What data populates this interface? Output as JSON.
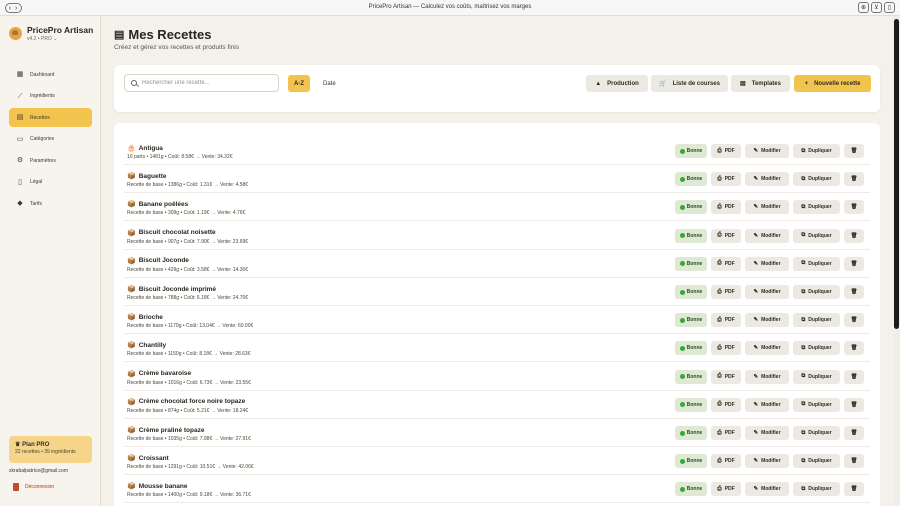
{
  "window": {
    "title": "PricePro Artisan — Calculez vos coûts, maîtrisez vos marges",
    "nav_glyph": "‹ ›",
    "icons": [
      "download-icon",
      "shopping-cart-icon",
      "sidebar-toggle-icon"
    ]
  },
  "sidebar": {
    "brand_name": "PricePro Artisan",
    "brand_version": "v4.2 • PRO ⌄",
    "items": [
      {
        "label": "Dashboard",
        "icon": "dashboard-icon",
        "glyph": "▦",
        "active": false
      },
      {
        "label": "Ingrédients",
        "icon": "whisk-icon",
        "glyph": "⟋",
        "active": false
      },
      {
        "label": "Recettes",
        "icon": "recipe-book-icon",
        "glyph": "▤",
        "active": true
      },
      {
        "label": "Catégories",
        "icon": "folder-icon",
        "glyph": "▭",
        "active": false
      },
      {
        "label": "Paramètres",
        "icon": "gear-icon",
        "glyph": "⚙",
        "active": false
      },
      {
        "label": "Légal",
        "icon": "document-icon",
        "glyph": "▯",
        "active": false
      },
      {
        "label": "Tarifs",
        "icon": "diamond-icon",
        "glyph": "◆",
        "active": false
      }
    ],
    "plan_title": "Plan PRO",
    "plan_icon": "crown-icon",
    "plan_glyph": "♛",
    "plan_stats": "22 recettes • 39 ingrédients",
    "user_email": "skrabalpatrice@gmail.com",
    "logout_label": "Déconnexion"
  },
  "main": {
    "title": "Mes Recettes",
    "title_glyph": "▤",
    "subtitle": "Créez et gérez vos recettes et produits finis",
    "search_placeholder": "Rechercher une recette...",
    "sort_az": "A-Z",
    "sort_date": "Date",
    "buttons": {
      "production": "Production",
      "shopping": "Liste de courses",
      "templates": "Templates",
      "new_recipe": "Nouvelle recette"
    },
    "button_glyphs": {
      "production": "▲",
      "shopping": "🛒",
      "templates": "▤",
      "new_recipe": "+"
    }
  },
  "row_actions": {
    "status": "Bonne",
    "pdf": "PDF",
    "edit": "Modifier",
    "duplicate": "Dupliquer",
    "pdf_glyph": "⎙",
    "edit_glyph": "✎",
    "duplicate_glyph": "⧉",
    "delete_glyph": "🗑"
  },
  "recipes": [
    {
      "name": "Antigua",
      "glyph": "🎂",
      "meta": "10 parts • 1481g • Coût: 8.58€ → Vente: 34.32€"
    },
    {
      "name": "Baguette",
      "glyph": "📦",
      "meta": "Recette de base • 1386g • Coût: 1.31€ → Vente: 4.58€"
    },
    {
      "name": "Banane poêlées",
      "glyph": "📦",
      "meta": "Recette de base • 309g • Coût: 1.19€ → Vente: 4.76€"
    },
    {
      "name": "Biscuit chocolat noisette",
      "glyph": "📦",
      "meta": "Recette de base • 907g • Coût: 7.90€ → Vente: 23.69€"
    },
    {
      "name": "Biscuit Joconde",
      "glyph": "📦",
      "meta": "Recette de base • 429g • Coût: 3.58€ → Vente: 14.30€"
    },
    {
      "name": "Biscuit Joconde imprimé",
      "glyph": "📦",
      "meta": "Recette de base • 788g • Coût: 6.18€ → Vente: 24.70€"
    },
    {
      "name": "Brioche",
      "glyph": "📦",
      "meta": "Recette de base • 1179g • Coût: 13.04€ → Vente: 60.00€"
    },
    {
      "name": "Chantilly",
      "glyph": "📦",
      "meta": "Recette de base • 1150g • Coût: 8.18€ → Vente: 28.63€"
    },
    {
      "name": "Crème bavaroise",
      "glyph": "📦",
      "meta": "Recette de base • 1016g • Coût: 6.73€ → Vente: 23.55€"
    },
    {
      "name": "Crème chocolat force noire topaze",
      "glyph": "📦",
      "meta": "Recette de base • 874g • Coût: 5.21€ → Vente: 18.24€"
    },
    {
      "name": "Crème praliné topaze",
      "glyph": "📦",
      "meta": "Recette de base • 1035g • Coût: 7.98€ → Vente: 27.91€"
    },
    {
      "name": "Croissant",
      "glyph": "📦",
      "meta": "Recette de base • 1291g • Coût: 10.51€ → Vente: 42.06€"
    },
    {
      "name": "Mousse banane",
      "glyph": "📦",
      "meta": "Recette de base • 1400g • Coût: 9.18€ → Vente: 36.71€"
    }
  ],
  "colors": {
    "accent": "#f2c44d",
    "background": "#f4f1ea",
    "status_ok": "#3aa53a",
    "logout": "#b13222"
  }
}
